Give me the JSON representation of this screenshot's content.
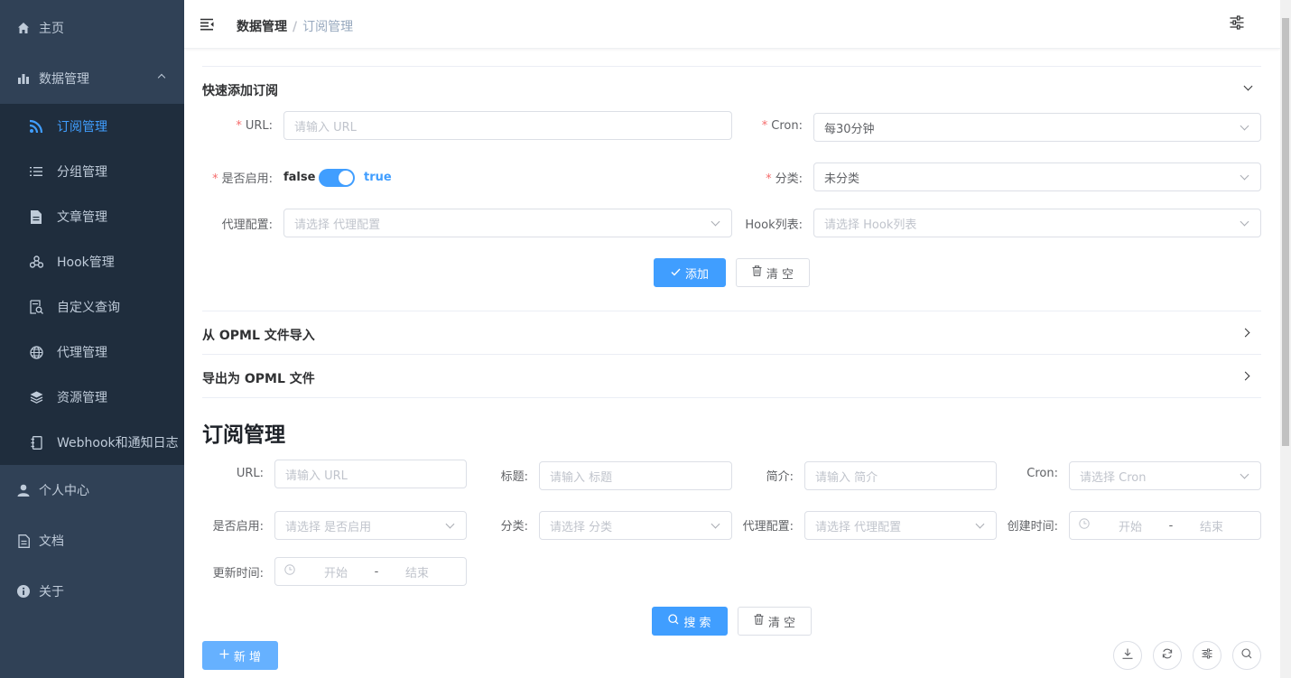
{
  "sidebar": {
    "home": "主页",
    "data_mgmt": "数据管理",
    "sub": [
      "订阅管理",
      "分组管理",
      "文章管理",
      "Hook管理",
      "自定义查询",
      "代理管理",
      "资源管理",
      "Webhook和通知日志"
    ],
    "personal": "个人中心",
    "docs": "文档",
    "about": "关于",
    "active_color": "#409eff",
    "bg_color": "#304156"
  },
  "header": {
    "breadcrumb_1": "数据管理",
    "breadcrumb_sep": "/",
    "breadcrumb_2": "订阅管理"
  },
  "quick_add": {
    "title": "快速添加订阅",
    "url_label": "URL:",
    "url_placeholder": "请输入 URL",
    "cron_label": "Cron:",
    "cron_value": "每30分钟",
    "enabled_label": "是否启用:",
    "switch_off": "false",
    "switch_on": "true",
    "category_label": "分类:",
    "category_value": "未分类",
    "proxy_label": "代理配置:",
    "proxy_placeholder": "请选择 代理配置",
    "hook_label": "Hook列表:",
    "hook_placeholder": "请选择 Hook列表",
    "add_button": "添加",
    "clear_button": "清 空"
  },
  "import_opml": "从 OPML 文件导入",
  "export_opml": "导出为 OPML 文件",
  "page_title": "订阅管理",
  "search": {
    "url_label": "URL:",
    "url_placeholder": "请输入 URL",
    "title_label": "标题:",
    "title_placeholder": "请输入 标题",
    "desc_label": "简介:",
    "desc_placeholder": "请输入 简介",
    "cron_label": "Cron:",
    "cron_placeholder": "请选择 Cron",
    "enabled_label": "是否启用:",
    "enabled_placeholder": "请选择 是否启用",
    "category_label": "分类:",
    "category_placeholder": "请选择 分类",
    "proxy_label": "代理配置:",
    "proxy_placeholder": "请选择 代理配置",
    "created_label": "创建时间:",
    "updated_label": "更新时间:",
    "range_start": "开始",
    "range_sep": "-",
    "range_end": "结束",
    "search_button": "搜 索",
    "clear_button": "清 空"
  },
  "toolbar": {
    "new_button": "新 增"
  }
}
